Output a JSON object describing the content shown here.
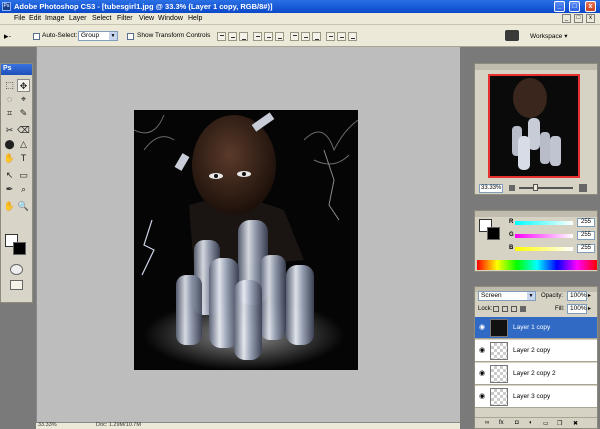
{
  "window": {
    "title": "Adobe Photoshop CS3 - [tubesgirl1.jpg @ 33.3% (Layer 1 copy, RGB/8#)]",
    "app_icon_text": "Ps",
    "minimize": "_",
    "maximize": "□",
    "close": "x"
  },
  "menu": [
    "File",
    "Edit",
    "Image",
    "Layer",
    "Select",
    "Filter",
    "View",
    "Window",
    "Help"
  ],
  "mdi_controls": [
    "_",
    "□",
    "x"
  ],
  "options": {
    "auto_select_label": "Auto-Select:",
    "auto_select_value": "Group",
    "show_transform_label": "Show Transform Controls",
    "workspace_label": "Workspace ▾"
  },
  "toolbox": {
    "header": "Ps",
    "tools": [
      "⬚",
      "✥",
      "◌",
      "⌖",
      "⌗",
      "✎",
      "✂",
      "⌫",
      "⬤",
      "△",
      "✋",
      "T",
      "↖",
      "▭",
      "✒",
      "⌕",
      "✋",
      "🔍"
    ]
  },
  "navigator": {
    "zoom": "33.33%"
  },
  "color": {
    "channels": [
      {
        "label": "R",
        "value": "255",
        "gradient": "linear-gradient(90deg,#00ffff,#ffffff)"
      },
      {
        "label": "G",
        "value": "255",
        "gradient": "linear-gradient(90deg,#ff00ff,#ffffff)"
      },
      {
        "label": "B",
        "value": "255",
        "gradient": "linear-gradient(90deg,#ffff00,#ffffff)"
      }
    ]
  },
  "layers": {
    "blend_mode": "Screen",
    "opacity_label": "Opacity:",
    "opacity_value": "100%",
    "lock_label": "Lock:",
    "fill_label": "Fill:",
    "fill_value": "100%",
    "rows": [
      {
        "name": "Layer 1 copy",
        "active": true,
        "dark": true
      },
      {
        "name": "Layer 2 copy",
        "active": false,
        "dark": false
      },
      {
        "name": "Layer 2 copy 2",
        "active": false,
        "dark": false
      },
      {
        "name": "Layer 3 copy",
        "active": false,
        "dark": false
      }
    ]
  },
  "status": {
    "zoom": "33.33%",
    "doc": "Doc: 1.29M/10.7M"
  }
}
